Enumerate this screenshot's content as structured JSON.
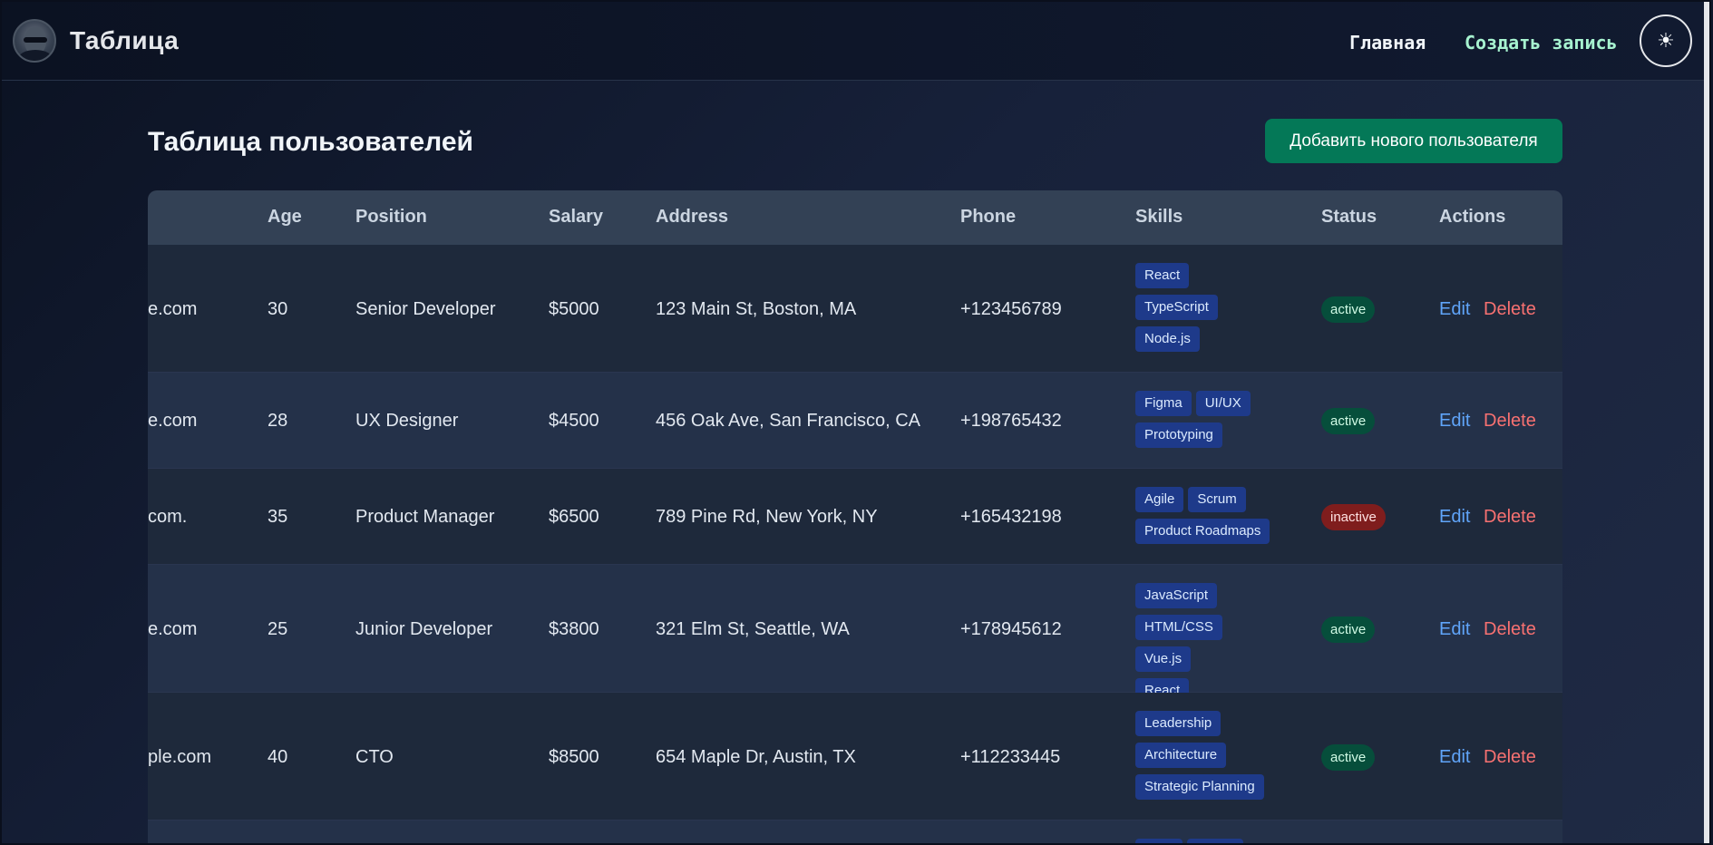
{
  "header": {
    "app_title": "Таблица",
    "nav": {
      "home": "Главная",
      "create": "Создать запись"
    },
    "theme_icon": "sun-icon"
  },
  "main": {
    "page_title": "Таблица пользователей",
    "add_button": "Добавить нового пользователя",
    "columns": [
      "Age",
      "Position",
      "Salary",
      "Address",
      "Phone",
      "Skills",
      "Status",
      "Actions"
    ],
    "rows": [
      {
        "email": "e.com",
        "age": "30",
        "position": "Senior Developer",
        "salary": "$5000",
        "address": "123 Main St, Boston, MA",
        "phone": "+123456789",
        "skills": [
          "React",
          "TypeScript",
          "Node.js"
        ],
        "status": "active",
        "edit": "Edit",
        "delete": "Delete"
      },
      {
        "email": "e.com",
        "age": "28",
        "position": "UX Designer",
        "salary": "$4500",
        "address": "456 Oak Ave, San Francisco, CA",
        "phone": "+198765432",
        "skills": [
          "Figma",
          "UI/UX",
          "Prototyping"
        ],
        "status": "active",
        "edit": "Edit",
        "delete": "Delete"
      },
      {
        "email": ".com",
        "age": "35",
        "position": "Product Manager",
        "salary": "$6500",
        "address": "789 Pine Rd, New York, NY",
        "phone": "+165432198",
        "skills": [
          "Agile",
          "Scrum",
          "Product Roadmaps"
        ],
        "status": "inactive",
        "edit": "Edit",
        "delete": "Delete"
      },
      {
        "email": "e.com",
        "age": "25",
        "position": "Junior Developer",
        "salary": "$3800",
        "address": "321 Elm St, Seattle, WA",
        "phone": "+178945612",
        "skills": [
          "JavaScript",
          "HTML/CSS",
          "Vue.js",
          "React"
        ],
        "status": "active",
        "edit": "Edit",
        "delete": "Delete"
      },
      {
        "email": "ple.com",
        "age": "40",
        "position": "CTO",
        "salary": "$8500",
        "address": "654 Maple Dr, Austin, TX",
        "phone": "+112233445",
        "skills": [
          "Leadership",
          "Architecture",
          "Strategic Planning"
        ],
        "status": "active",
        "edit": "Edit",
        "delete": "Delete"
      }
    ]
  },
  "colors": {
    "accent_green": "#047857",
    "link_blue": "#60a5fa",
    "danger_red": "#f87171",
    "skill_bg": "#1e3a8a"
  }
}
